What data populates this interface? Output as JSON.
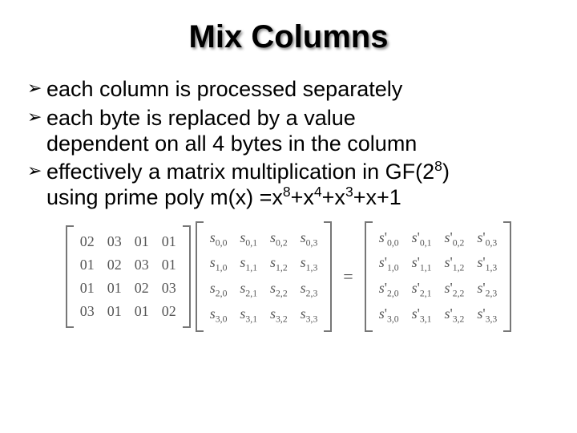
{
  "title": "Mix Columns",
  "bullets": [
    "each column is processed separately",
    "each byte is replaced by a value dependent on all 4 bytes in the column",
    "effectively a matrix multiplication in GF(2⁸) using prime poly m(x) =x⁸+x⁴+x³+x+1"
  ],
  "eq": "=",
  "chart_data": {
    "type": "table",
    "title": "MixColumns matrix equation",
    "coef_matrix": [
      [
        "02",
        "03",
        "01",
        "01"
      ],
      [
        "01",
        "02",
        "03",
        "01"
      ],
      [
        "01",
        "01",
        "02",
        "03"
      ],
      [
        "03",
        "01",
        "01",
        "02"
      ]
    ],
    "state_in": [
      [
        "s0,0",
        "s0,1",
        "s0,2",
        "s0,3"
      ],
      [
        "s1,0",
        "s1,1",
        "s1,2",
        "s1,3"
      ],
      [
        "s2,0",
        "s2,1",
        "s2,2",
        "s2,3"
      ],
      [
        "s3,0",
        "s3,1",
        "s3,2",
        "s3,3"
      ]
    ],
    "state_out": [
      [
        "s'0,0",
        "s'0,1",
        "s'0,2",
        "s'0,3"
      ],
      [
        "s'1,0",
        "s'1,1",
        "s'1,2",
        "s'1,3"
      ],
      [
        "s'2,0",
        "s'2,1",
        "s'2,2",
        "s'2,3"
      ],
      [
        "s'3,0",
        "s'3,1",
        "s'3,2",
        "s'3,3"
      ]
    ]
  }
}
